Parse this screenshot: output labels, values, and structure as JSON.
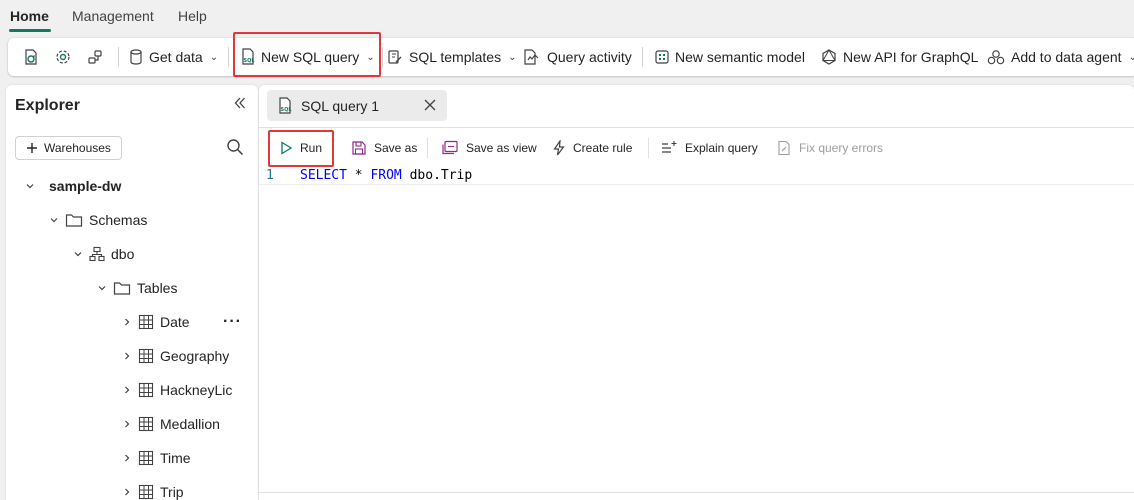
{
  "menu_tabs": [
    {
      "label": "Home",
      "active": true
    },
    {
      "label": "Management",
      "active": false
    },
    {
      "label": "Help",
      "active": false
    }
  ],
  "ribbon": {
    "get_data": "Get data",
    "new_sql_query": "New SQL query",
    "sql_templates": "SQL templates",
    "query_activity": "Query activity",
    "new_semantic_model": "New semantic model",
    "new_api_graphql": "New API for GraphQL",
    "add_to_data_agent": "Add to data agent"
  },
  "explorer": {
    "title": "Explorer",
    "warehouses_button": "Warehouses",
    "tree": {
      "warehouse": "sample-dw",
      "schemas": "Schemas",
      "schema": "dbo",
      "tables": "Tables",
      "table_items": [
        "Date",
        "Geography",
        "HackneyLic",
        "Medallion",
        "Time",
        "Trip"
      ]
    }
  },
  "editor_tab": {
    "label": "SQL query 1"
  },
  "query_toolbar": {
    "run": "Run",
    "save_as": "Save as",
    "save_as_view": "Save as view",
    "create_rule": "Create rule",
    "explain_query": "Explain query",
    "fix_query_errors": "Fix query errors"
  },
  "editor": {
    "line_number": "1",
    "kw_select": "SELECT",
    "star": " * ",
    "kw_from": "FROM",
    "table_ref": " dbo.Trip"
  },
  "colors": {
    "accent": "#117865",
    "highlight": "#e0363c",
    "keyword": "#0000ff"
  }
}
